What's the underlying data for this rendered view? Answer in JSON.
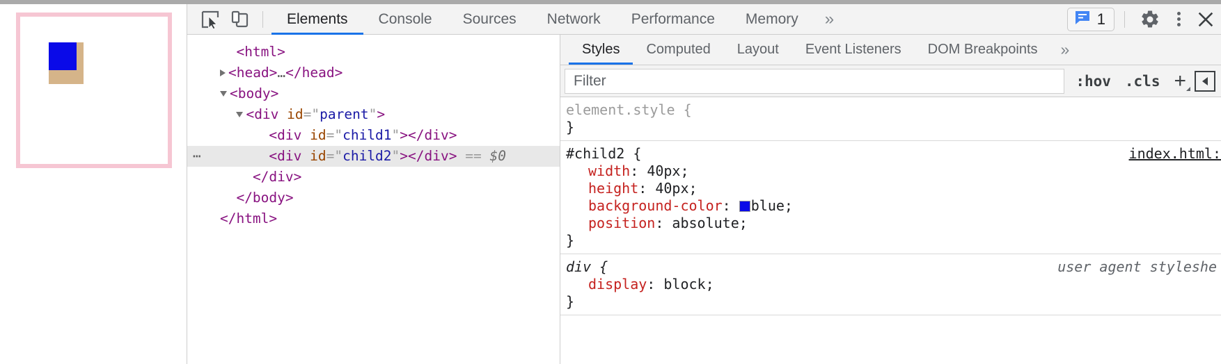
{
  "page_preview": {
    "parent_border_color": "#f6c6d3",
    "child1_color": "#d5b489",
    "child2_color": "#0a0ae8"
  },
  "toolbar": {
    "inspect_icon": "inspect-element-icon",
    "device_icon": "device-toolbar-icon",
    "tabs": [
      {
        "label": "Elements",
        "active": true
      },
      {
        "label": "Console",
        "active": false
      },
      {
        "label": "Sources",
        "active": false
      },
      {
        "label": "Network",
        "active": false
      },
      {
        "label": "Performance",
        "active": false
      },
      {
        "label": "Memory",
        "active": false
      }
    ],
    "more_tabs_label": "»",
    "message_count": "1",
    "message_icon": "message-bubble-icon",
    "message_icon_color": "#4285f4",
    "settings_icon": "gear-icon",
    "more_icon": "vertical-dots-icon",
    "close_icon": "close-icon"
  },
  "dom_tree": {
    "lines": [
      {
        "indent": 1,
        "twisty": "none",
        "badge": "",
        "parts": [
          {
            "t": "tag",
            "v": "<html>"
          }
        ],
        "selected": false
      },
      {
        "indent": 1,
        "twisty": "closed",
        "badge": "",
        "parts": [
          {
            "t": "tag",
            "v": "<head>"
          },
          {
            "t": "ellip",
            "v": "…"
          },
          {
            "t": "tag",
            "v": "</head>"
          }
        ],
        "selected": false
      },
      {
        "indent": 1,
        "twisty": "open",
        "badge": "",
        "parts": [
          {
            "t": "tag",
            "v": "<body>"
          }
        ],
        "selected": false
      },
      {
        "indent": 2,
        "twisty": "open",
        "badge": "",
        "parts": [
          {
            "t": "tag",
            "v": "<div"
          },
          {
            "t": "sp",
            "v": " "
          },
          {
            "t": "attr-name",
            "v": "id"
          },
          {
            "t": "punc",
            "v": "=\""
          },
          {
            "t": "attr-val",
            "v": "parent"
          },
          {
            "t": "punc",
            "v": "\""
          },
          {
            "t": "tag",
            "v": ">"
          }
        ],
        "selected": false
      },
      {
        "indent": 3,
        "twisty": "none",
        "badge": "",
        "parts": [
          {
            "t": "tag",
            "v": "<div"
          },
          {
            "t": "sp",
            "v": " "
          },
          {
            "t": "attr-name",
            "v": "id"
          },
          {
            "t": "punc",
            "v": "=\""
          },
          {
            "t": "attr-val",
            "v": "child1"
          },
          {
            "t": "punc",
            "v": "\""
          },
          {
            "t": "tag",
            "v": ">"
          },
          {
            "t": "tag",
            "v": "</div>"
          }
        ],
        "selected": false
      },
      {
        "indent": 3,
        "twisty": "none",
        "badge": "…",
        "parts": [
          {
            "t": "tag",
            "v": "<div"
          },
          {
            "t": "sp",
            "v": " "
          },
          {
            "t": "attr-name",
            "v": "id"
          },
          {
            "t": "punc",
            "v": "=\""
          },
          {
            "t": "attr-val",
            "v": "child2"
          },
          {
            "t": "punc",
            "v": "\""
          },
          {
            "t": "tag",
            "v": ">"
          },
          {
            "t": "tag",
            "v": "</div>"
          },
          {
            "t": "sp",
            "v": " "
          },
          {
            "t": "punc",
            "v": "=="
          },
          {
            "t": "sp",
            "v": " "
          },
          {
            "t": "eq0",
            "v": "$0"
          }
        ],
        "selected": true
      },
      {
        "indent": 2,
        "twisty": "none",
        "badge": "",
        "parts": [
          {
            "t": "tag",
            "v": "</div>"
          }
        ],
        "selected": false
      },
      {
        "indent": 1,
        "twisty": "none",
        "badge": "",
        "parts": [
          {
            "t": "tag",
            "v": "</body>"
          }
        ],
        "selected": false
      },
      {
        "indent": 0,
        "twisty": "none",
        "badge": "",
        "parts": [
          {
            "t": "tag",
            "v": "</html>"
          }
        ],
        "selected": false
      }
    ]
  },
  "styles_panel": {
    "tabs": [
      {
        "label": "Styles",
        "active": true
      },
      {
        "label": "Computed",
        "active": false
      },
      {
        "label": "Layout",
        "active": false
      },
      {
        "label": "Event Listeners",
        "active": false
      },
      {
        "label": "DOM Breakpoints",
        "active": false
      }
    ],
    "more_tabs_label": "»",
    "filter_placeholder": "Filter",
    "filter_value": "",
    "hov_label": ":hov",
    "cls_label": ".cls",
    "plus_label": "+",
    "new_style_rule_icon": "new-style-rule-icon",
    "rules": [
      {
        "selector": "element.style {",
        "selector_style": "muted",
        "origin": "",
        "declarations": [],
        "close": "}"
      },
      {
        "selector": "#child2 {",
        "selector_style": "normal",
        "origin": "index.html:",
        "declarations": [
          {
            "prop": "width",
            "value": "40px;",
            "swatch": ""
          },
          {
            "prop": "height",
            "value": "40px;",
            "swatch": ""
          },
          {
            "prop": "background-color",
            "value": "blue;",
            "swatch": "#0a0ae8"
          },
          {
            "prop": "position",
            "value": "absolute;",
            "swatch": ""
          }
        ],
        "close": "}"
      },
      {
        "selector": "div {",
        "selector_style": "ua",
        "origin": "user agent styleshe",
        "declarations": [
          {
            "prop": "display",
            "value": "block;",
            "swatch": ""
          }
        ],
        "close": "}"
      }
    ]
  }
}
